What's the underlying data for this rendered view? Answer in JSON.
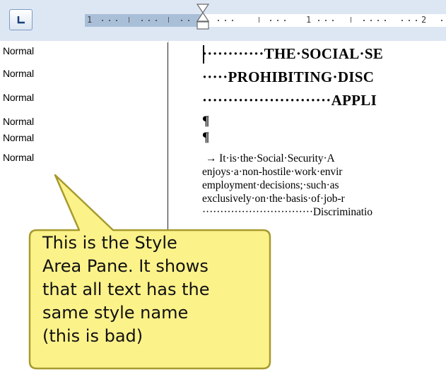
{
  "ruler": {
    "tab_selector_icon": "left-tab-stop-icon",
    "numbers": [
      "1",
      "1",
      "2"
    ]
  },
  "style_area": {
    "style_names": [
      "Normal",
      "Normal",
      "Normal",
      "Normal",
      "Normal",
      "Normal"
    ]
  },
  "document": {
    "headings": [
      "············THE·SOCIAL·SE",
      "·····PROHIBITING·DISC",
      "·························APPLI"
    ],
    "pilcrows": [
      "¶",
      "¶"
    ],
    "body_lines": [
      "→    It·is·the·Social·Security·A",
      "enjoys·a·non-hostile·work·envir",
      "employment·decisions;·such·as",
      "exclusively·on·the·basis·of·job-r",
      "·······························Discriminatio"
    ]
  },
  "callout": {
    "lines": [
      "This is the Style",
      "Area Pane. It shows",
      "that all text has the",
      "same style name",
      "(this is bad)"
    ],
    "fill_color": "#fcf28a",
    "border_color": "#a79a2e"
  }
}
